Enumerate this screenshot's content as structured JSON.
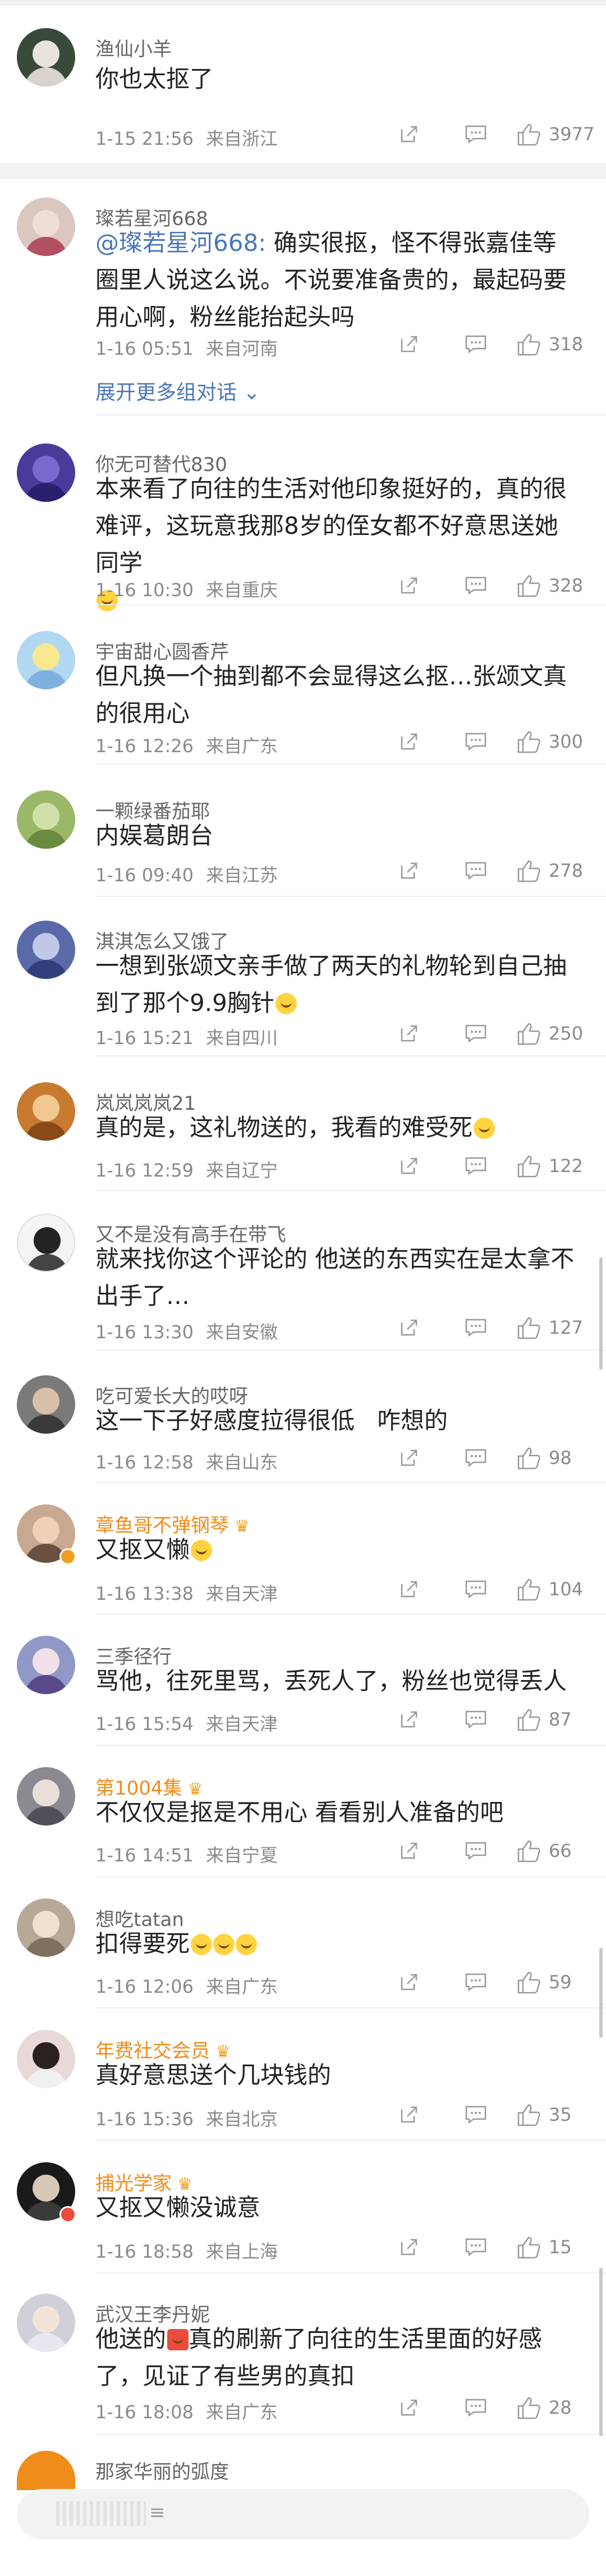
{
  "comments": [
    {
      "user": "渔仙小羊",
      "text": "你也太抠了",
      "time": "1-15 21:56",
      "location": "来自浙江",
      "likes": "3977"
    },
    {
      "user": "璨若星河668",
      "mention": "@璨若星河668:",
      "text": " 确实很抠，怪不得张嘉佳等圈里人说这么说。不说要准备贵的，最起码要用心啊，粉丝能抬起头吗",
      "time": "1-16 05:51",
      "location": "来自河南",
      "likes": "318",
      "expand": "展开更多组对话"
    },
    {
      "user": "你无可替代830",
      "text": "本来看了向往的生活对他印象挺好的，真的很难评，这玩意我那8岁的侄女都不好意思送她同学",
      "time": "1-16 10:30",
      "location": "来自重庆",
      "likes": "328"
    },
    {
      "user": "宇宙甜心圆香芹",
      "text": "但凡换一个抽到都不会显得这么抠…张颂文真的很用心",
      "time": "1-16 12:26",
      "location": "来自广东",
      "likes": "300"
    },
    {
      "user": "一颗绿番茄耶",
      "text": "内娱葛朗台",
      "time": "1-16 09:40",
      "location": "来自江苏",
      "likes": "278"
    },
    {
      "user": "淇淇怎么又饿了",
      "text": "一想到张颂文亲手做了两天的礼物轮到自己抽到了那个9.9胸针",
      "time": "1-16 15:21",
      "location": "来自四川",
      "likes": "250"
    },
    {
      "user": "岚岚岚岚21",
      "text": "真的是，这礼物送的，我看的难受死",
      "time": "1-16 12:59",
      "location": "来自辽宁",
      "likes": "122"
    },
    {
      "user": "又不是没有高手在带飞",
      "text": "就来找你这个评论的 他送的东西实在是太拿不出手了…",
      "time": "1-16 13:30",
      "location": "来自安徽",
      "likes": "127"
    },
    {
      "user": "吃可爱长大的哎呀",
      "text": "这一下子好感度拉得很低   咋想的",
      "time": "1-16 12:58",
      "location": "来自山东",
      "likes": "98"
    },
    {
      "user": "章鱼哥不弹钢琴",
      "text": "又抠又懒",
      "time": "1-16 13:38",
      "location": "来自天津",
      "likes": "104"
    },
    {
      "user": "三季径行",
      "text": "骂他，往死里骂，丢死人了，粉丝也觉得丢人",
      "time": "1-16 15:54",
      "location": "来自天津",
      "likes": "87"
    },
    {
      "user": "第1004集",
      "text": "不仅仅是抠是不用心 看看别人准备的吧",
      "time": "1-16 14:51",
      "location": "来自宁夏",
      "likes": "66"
    },
    {
      "user": "想吃tatan",
      "text": "扣得要死",
      "time": "1-16 12:06",
      "location": "来自广东",
      "likes": "59"
    },
    {
      "user": "年费社交会员",
      "text": "真好意思送个几块钱的",
      "time": "1-16 15:36",
      "location": "来自北京",
      "likes": "35"
    },
    {
      "user": "捕光学家",
      "text": "又抠又懒没诚意",
      "time": "1-16 18:58",
      "location": "来自上海",
      "likes": "15"
    },
    {
      "user": "武汉王李丹妮",
      "text": "他送的",
      "text2": "真的刷新了向往的生活里面的好感了，见证了有些男的真扣",
      "time": "1-16 18:08",
      "location": "来自广东",
      "likes": "28"
    },
    {
      "user": "那家华丽的弧度"
    }
  ],
  "input": {
    "hint": "≡"
  },
  "colors": {
    "accent": "#4a76b8",
    "vip": "#f08c19",
    "meta": "#8a8a8a"
  }
}
